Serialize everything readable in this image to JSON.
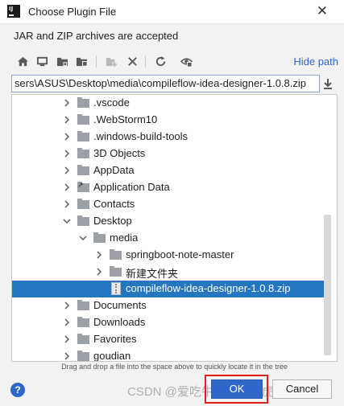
{
  "window": {
    "title": "Choose Plugin File",
    "close_glyph": "✕"
  },
  "description": "JAR and ZIP archives are accepted",
  "toolbar": {
    "icons": [
      "home-icon",
      "desktop-icon",
      "project-folder-icon",
      "module-folder-icon",
      "new-folder-icon",
      "delete-icon",
      "refresh-icon",
      "show-hidden-icon"
    ],
    "hide_path_label": "Hide path"
  },
  "path": {
    "value": "sers\\ASUS\\Desktop\\media\\compileflow-idea-designer-1.0.8.zip"
  },
  "tree": {
    "items": [
      {
        "label": ".vscode",
        "type": "folder",
        "indent": 1,
        "expanded": false,
        "selected": false
      },
      {
        "label": ".WebStorm10",
        "type": "folder",
        "indent": 1,
        "expanded": false,
        "selected": false
      },
      {
        "label": ".windows-build-tools",
        "type": "folder",
        "indent": 1,
        "expanded": false,
        "selected": false
      },
      {
        "label": "3D Objects",
        "type": "folder",
        "indent": 1,
        "expanded": false,
        "selected": false
      },
      {
        "label": "AppData",
        "type": "folder",
        "indent": 1,
        "expanded": false,
        "selected": false
      },
      {
        "label": "Application Data",
        "type": "shortcut",
        "indent": 1,
        "expanded": false,
        "selected": false
      },
      {
        "label": "Contacts",
        "type": "folder",
        "indent": 1,
        "expanded": false,
        "selected": false
      },
      {
        "label": "Desktop",
        "type": "folder",
        "indent": 1,
        "expanded": true,
        "selected": false
      },
      {
        "label": "media",
        "type": "folder",
        "indent": 2,
        "expanded": true,
        "selected": false
      },
      {
        "label": "springboot-note-master",
        "type": "folder",
        "indent": 3,
        "expanded": false,
        "selected": false
      },
      {
        "label": "新建文件夹",
        "type": "folder",
        "indent": 3,
        "expanded": false,
        "selected": false
      },
      {
        "label": "compileflow-idea-designer-1.0.8.zip",
        "type": "zip",
        "indent": 3,
        "expanded": false,
        "selected": true
      },
      {
        "label": "Documents",
        "type": "folder",
        "indent": 1,
        "expanded": false,
        "selected": false
      },
      {
        "label": "Downloads",
        "type": "folder",
        "indent": 1,
        "expanded": false,
        "selected": false
      },
      {
        "label": "Favorites",
        "type": "folder",
        "indent": 1,
        "expanded": false,
        "selected": false
      },
      {
        "label": "goudian",
        "type": "folder",
        "indent": 1,
        "expanded": false,
        "selected": false
      }
    ]
  },
  "hint": "Drag and drop a file into the space above to quickly locate it in the tree",
  "footer": {
    "help_glyph": "?",
    "ok_label": "OK",
    "cancel_label": "Cancel"
  },
  "watermark": "CSDN @爱吃牛肉的大老虎",
  "colors": {
    "accent": "#2f66c9",
    "selection": "#2675bf",
    "highlight_box": "#e01e1e"
  }
}
